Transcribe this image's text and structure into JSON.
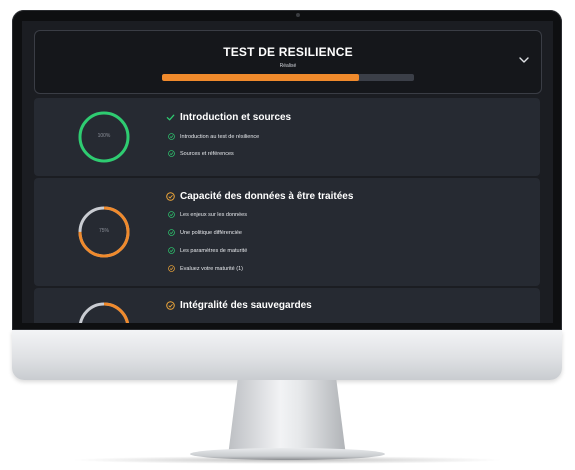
{
  "header": {
    "title": "TEST DE RESILIENCE",
    "subtitle": "Réalisé",
    "progress": 0.78
  },
  "colors": {
    "accent": "#f08a2c",
    "success": "#2ecc71",
    "warning": "#f0a73a",
    "card_bg": "#262a32",
    "screen_bg": "#1b1d22"
  },
  "sections": [
    {
      "title": "Introduction et sources",
      "ring_label": "100%",
      "ring_value": 1.0,
      "status_icon": "check-icon",
      "items": [
        {
          "label": "Introduction au test de résilience",
          "icon": "check-circle-icon"
        },
        {
          "label": "Sources et références",
          "icon": "check-circle-icon"
        }
      ]
    },
    {
      "title": "Capacité des données à être traitées",
      "ring_label": "75%",
      "ring_value": 0.75,
      "status_icon": "warning-circle-icon",
      "items": [
        {
          "label": "Les enjeux sur les données",
          "icon": "check-circle-icon"
        },
        {
          "label": "Une politique différenciée",
          "icon": "check-circle-icon"
        },
        {
          "label": "Les paramètres de maturité",
          "icon": "check-circle-icon"
        },
        {
          "label": "Evaluez votre maturité (1)",
          "icon": "warning-circle-icon"
        }
      ]
    },
    {
      "title": "Intégralité des sauvegardes",
      "ring_label": "",
      "ring_value": 0.75,
      "status_icon": "warning-circle-icon",
      "items": []
    }
  ]
}
